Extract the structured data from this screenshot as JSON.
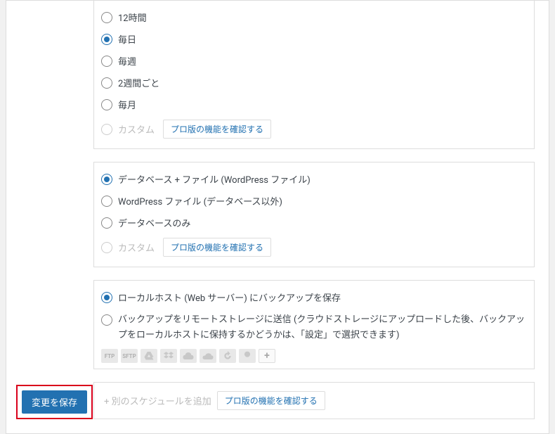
{
  "frequency": {
    "options": [
      {
        "label": "12時間",
        "checked": false
      },
      {
        "label": "毎日",
        "checked": true
      },
      {
        "label": "毎週",
        "checked": false
      },
      {
        "label": "2週間ごと",
        "checked": false
      },
      {
        "label": "毎月",
        "checked": false
      }
    ],
    "custom_label": "カスタム",
    "pro_link": "プロ版の機能を確認する"
  },
  "content": {
    "options": [
      {
        "label": "データベース + ファイル (WordPress ファイル)",
        "checked": true
      },
      {
        "label": "WordPress ファイル (データベース以外)",
        "checked": false
      },
      {
        "label": "データベースのみ",
        "checked": false
      }
    ],
    "custom_label": "カスタム",
    "pro_link": "プロ版の機能を確認する"
  },
  "destination": {
    "options": [
      {
        "label": "ローカルホスト (Web サーバー) にバックアップを保存",
        "checked": true
      },
      {
        "label": "バックアップをリモートストレージに送信 (クラウドストレージにアップロードした後、バックアップをローカルホストに保持するかどうかは、「設定」で選択できます)",
        "checked": false
      }
    ],
    "icons": {
      "ftp": "FTP",
      "sftp": "SFTP",
      "plus": "+"
    }
  },
  "add_schedule": {
    "label": "+ 別のスケジュールを追加",
    "pro_link": "プロ版の機能を確認する"
  },
  "save_button": "変更を保存"
}
